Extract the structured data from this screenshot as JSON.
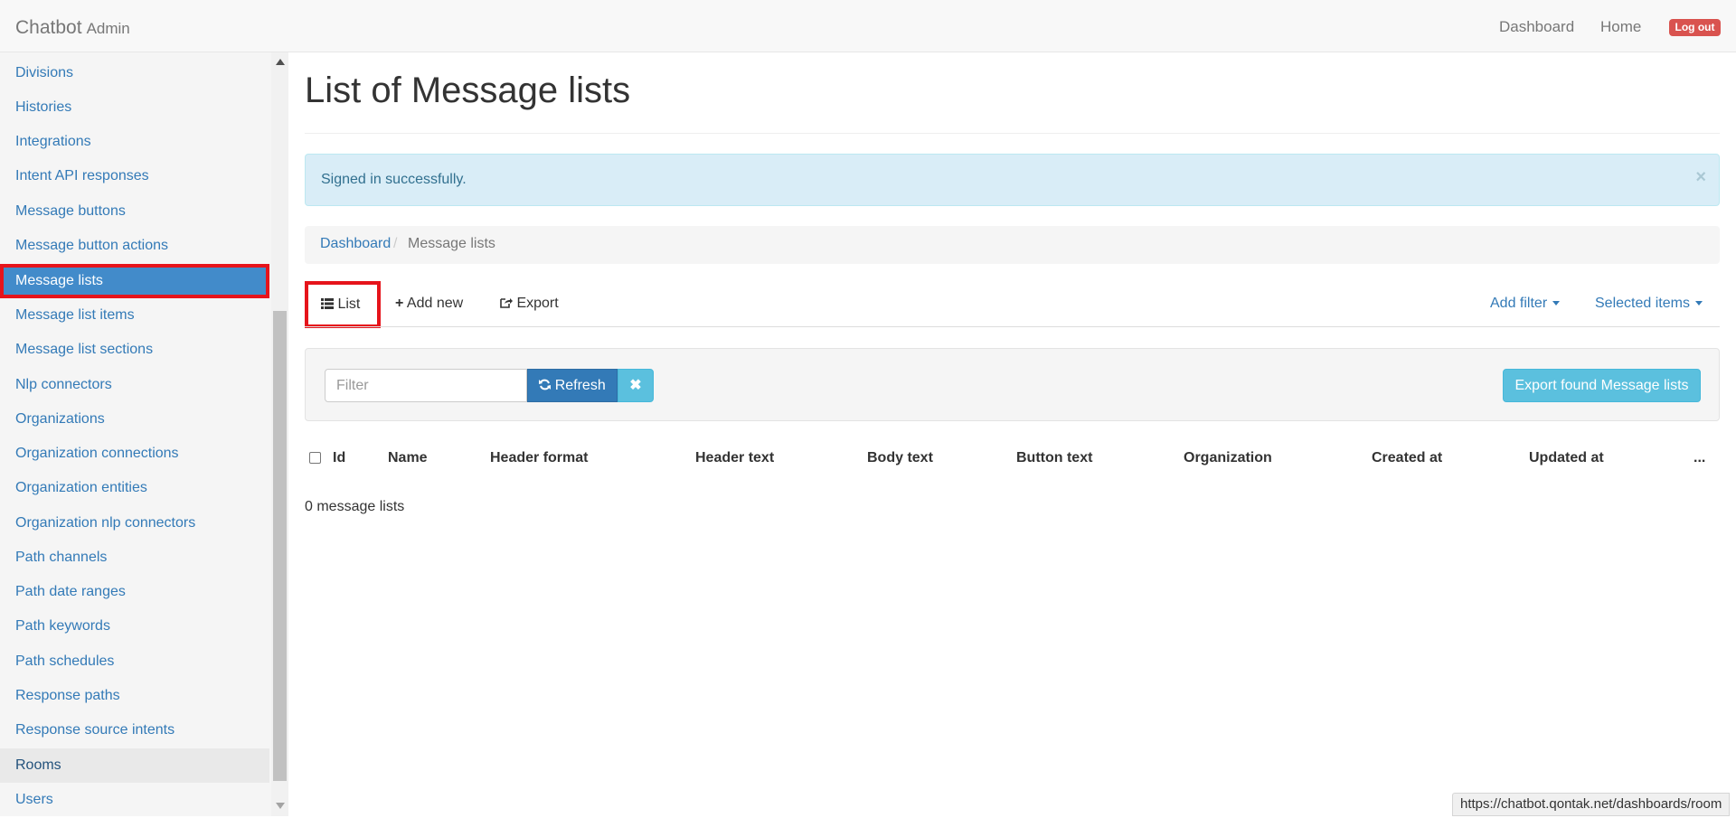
{
  "navbar": {
    "brand": "Chatbot",
    "brand_sub": "Admin",
    "links": [
      "Dashboard",
      "Home"
    ],
    "logout": "Log out"
  },
  "sidebar": {
    "items": [
      {
        "label": "Divisions"
      },
      {
        "label": "Histories"
      },
      {
        "label": "Integrations"
      },
      {
        "label": "Intent API responses"
      },
      {
        "label": "Message buttons"
      },
      {
        "label": "Message button actions"
      },
      {
        "label": "Message lists",
        "state": "active"
      },
      {
        "label": "Message list items"
      },
      {
        "label": "Message list sections"
      },
      {
        "label": "Nlp connectors"
      },
      {
        "label": "Organizations"
      },
      {
        "label": "Organization connections"
      },
      {
        "label": "Organization entities"
      },
      {
        "label": "Organization nlp connectors"
      },
      {
        "label": "Path channels"
      },
      {
        "label": "Path date ranges"
      },
      {
        "label": "Path keywords"
      },
      {
        "label": "Path schedules"
      },
      {
        "label": "Response paths"
      },
      {
        "label": "Response source intents"
      },
      {
        "label": "Rooms",
        "state": "hover"
      },
      {
        "label": "Users"
      }
    ]
  },
  "main": {
    "title": "List of Message lists",
    "alert": {
      "text": "Signed in successfully.",
      "close": "×"
    },
    "breadcrumb": {
      "home": "Dashboard",
      "separator": "/",
      "current": "Message lists"
    },
    "tabs": {
      "list": "List",
      "add_new": "Add new",
      "export": "Export",
      "add_filter": "Add filter",
      "selected_items": "Selected items"
    },
    "filter": {
      "placeholder": "Filter",
      "refresh": "Refresh",
      "clear": "✖",
      "export_found": "Export found Message lists"
    },
    "table": {
      "columns": [
        "Id",
        "Name",
        "Header format",
        "Header text",
        "Body text",
        "Button text",
        "Organization",
        "Created at",
        "Updated at",
        "..."
      ]
    },
    "count_text": "0 message lists"
  },
  "status_bar": {
    "url": "https://chatbot.qontak.net/dashboards/room"
  },
  "colors": {
    "link": "#337ab7",
    "active_bg": "#428bca",
    "highlight_border": "#e6141b",
    "alert_bg": "#d9edf7",
    "danger": "#d9534f",
    "info": "#5bc0de"
  }
}
